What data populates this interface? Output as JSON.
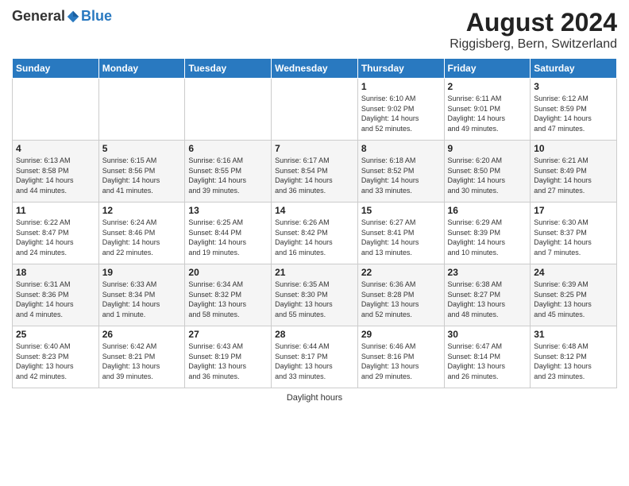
{
  "logo": {
    "general": "General",
    "blue": "Blue"
  },
  "title": "August 2024",
  "subtitle": "Riggisberg, Bern, Switzerland",
  "days_of_week": [
    "Sunday",
    "Monday",
    "Tuesday",
    "Wednesday",
    "Thursday",
    "Friday",
    "Saturday"
  ],
  "weeks": [
    [
      {
        "day": "",
        "info": ""
      },
      {
        "day": "",
        "info": ""
      },
      {
        "day": "",
        "info": ""
      },
      {
        "day": "",
        "info": ""
      },
      {
        "day": "1",
        "info": "Sunrise: 6:10 AM\nSunset: 9:02 PM\nDaylight: 14 hours\nand 52 minutes."
      },
      {
        "day": "2",
        "info": "Sunrise: 6:11 AM\nSunset: 9:01 PM\nDaylight: 14 hours\nand 49 minutes."
      },
      {
        "day": "3",
        "info": "Sunrise: 6:12 AM\nSunset: 8:59 PM\nDaylight: 14 hours\nand 47 minutes."
      }
    ],
    [
      {
        "day": "4",
        "info": "Sunrise: 6:13 AM\nSunset: 8:58 PM\nDaylight: 14 hours\nand 44 minutes."
      },
      {
        "day": "5",
        "info": "Sunrise: 6:15 AM\nSunset: 8:56 PM\nDaylight: 14 hours\nand 41 minutes."
      },
      {
        "day": "6",
        "info": "Sunrise: 6:16 AM\nSunset: 8:55 PM\nDaylight: 14 hours\nand 39 minutes."
      },
      {
        "day": "7",
        "info": "Sunrise: 6:17 AM\nSunset: 8:54 PM\nDaylight: 14 hours\nand 36 minutes."
      },
      {
        "day": "8",
        "info": "Sunrise: 6:18 AM\nSunset: 8:52 PM\nDaylight: 14 hours\nand 33 minutes."
      },
      {
        "day": "9",
        "info": "Sunrise: 6:20 AM\nSunset: 8:50 PM\nDaylight: 14 hours\nand 30 minutes."
      },
      {
        "day": "10",
        "info": "Sunrise: 6:21 AM\nSunset: 8:49 PM\nDaylight: 14 hours\nand 27 minutes."
      }
    ],
    [
      {
        "day": "11",
        "info": "Sunrise: 6:22 AM\nSunset: 8:47 PM\nDaylight: 14 hours\nand 24 minutes."
      },
      {
        "day": "12",
        "info": "Sunrise: 6:24 AM\nSunset: 8:46 PM\nDaylight: 14 hours\nand 22 minutes."
      },
      {
        "day": "13",
        "info": "Sunrise: 6:25 AM\nSunset: 8:44 PM\nDaylight: 14 hours\nand 19 minutes."
      },
      {
        "day": "14",
        "info": "Sunrise: 6:26 AM\nSunset: 8:42 PM\nDaylight: 14 hours\nand 16 minutes."
      },
      {
        "day": "15",
        "info": "Sunrise: 6:27 AM\nSunset: 8:41 PM\nDaylight: 14 hours\nand 13 minutes."
      },
      {
        "day": "16",
        "info": "Sunrise: 6:29 AM\nSunset: 8:39 PM\nDaylight: 14 hours\nand 10 minutes."
      },
      {
        "day": "17",
        "info": "Sunrise: 6:30 AM\nSunset: 8:37 PM\nDaylight: 14 hours\nand 7 minutes."
      }
    ],
    [
      {
        "day": "18",
        "info": "Sunrise: 6:31 AM\nSunset: 8:36 PM\nDaylight: 14 hours\nand 4 minutes."
      },
      {
        "day": "19",
        "info": "Sunrise: 6:33 AM\nSunset: 8:34 PM\nDaylight: 14 hours\nand 1 minute."
      },
      {
        "day": "20",
        "info": "Sunrise: 6:34 AM\nSunset: 8:32 PM\nDaylight: 13 hours\nand 58 minutes."
      },
      {
        "day": "21",
        "info": "Sunrise: 6:35 AM\nSunset: 8:30 PM\nDaylight: 13 hours\nand 55 minutes."
      },
      {
        "day": "22",
        "info": "Sunrise: 6:36 AM\nSunset: 8:28 PM\nDaylight: 13 hours\nand 52 minutes."
      },
      {
        "day": "23",
        "info": "Sunrise: 6:38 AM\nSunset: 8:27 PM\nDaylight: 13 hours\nand 48 minutes."
      },
      {
        "day": "24",
        "info": "Sunrise: 6:39 AM\nSunset: 8:25 PM\nDaylight: 13 hours\nand 45 minutes."
      }
    ],
    [
      {
        "day": "25",
        "info": "Sunrise: 6:40 AM\nSunset: 8:23 PM\nDaylight: 13 hours\nand 42 minutes."
      },
      {
        "day": "26",
        "info": "Sunrise: 6:42 AM\nSunset: 8:21 PM\nDaylight: 13 hours\nand 39 minutes."
      },
      {
        "day": "27",
        "info": "Sunrise: 6:43 AM\nSunset: 8:19 PM\nDaylight: 13 hours\nand 36 minutes."
      },
      {
        "day": "28",
        "info": "Sunrise: 6:44 AM\nSunset: 8:17 PM\nDaylight: 13 hours\nand 33 minutes."
      },
      {
        "day": "29",
        "info": "Sunrise: 6:46 AM\nSunset: 8:16 PM\nDaylight: 13 hours\nand 29 minutes."
      },
      {
        "day": "30",
        "info": "Sunrise: 6:47 AM\nSunset: 8:14 PM\nDaylight: 13 hours\nand 26 minutes."
      },
      {
        "day": "31",
        "info": "Sunrise: 6:48 AM\nSunset: 8:12 PM\nDaylight: 13 hours\nand 23 minutes."
      }
    ]
  ],
  "footer": "Daylight hours"
}
